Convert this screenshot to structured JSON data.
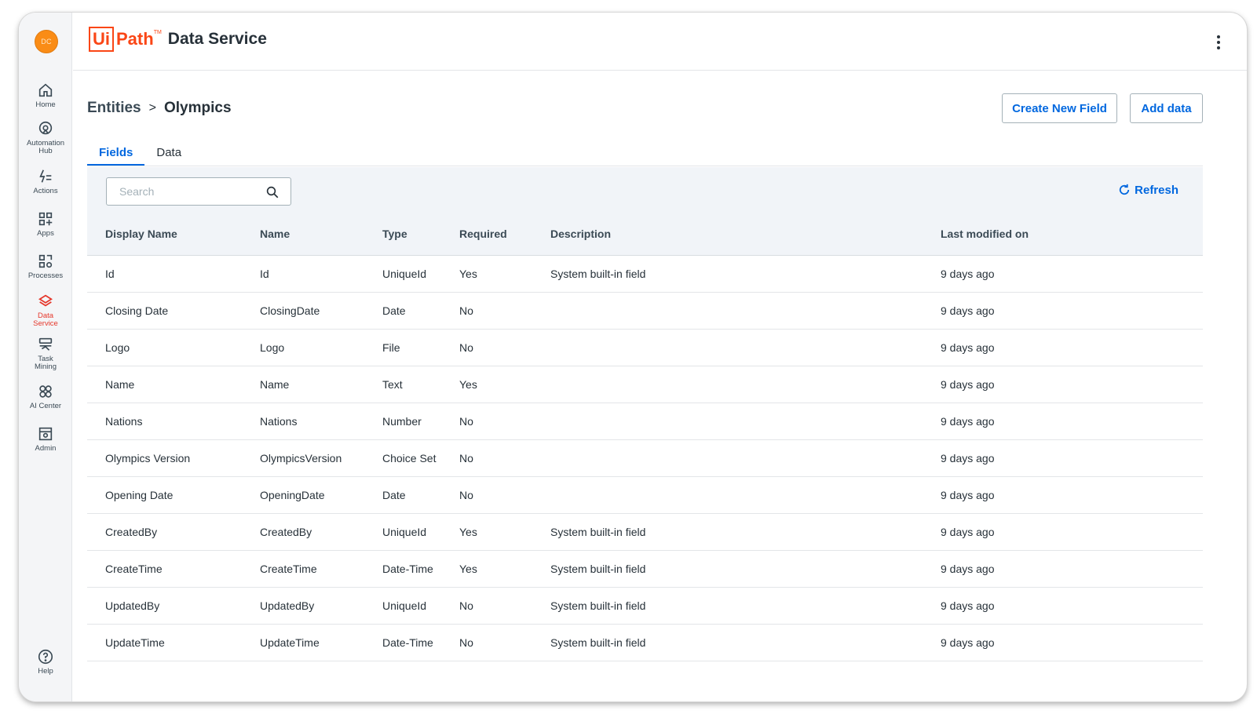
{
  "user": {
    "initials": "DC"
  },
  "nav": [
    {
      "label": "Home",
      "icon": "home-icon"
    },
    {
      "label": "Automation Hub",
      "icon": "automation-hub-icon"
    },
    {
      "label": "Actions",
      "icon": "actions-icon"
    },
    {
      "label": "Apps",
      "icon": "apps-icon"
    },
    {
      "label": "Processes",
      "icon": "processes-icon"
    },
    {
      "label": "Data Service",
      "icon": "data-service-icon",
      "active": true
    },
    {
      "label": "Task Mining",
      "icon": "task-mining-icon"
    },
    {
      "label": "AI Center",
      "icon": "ai-center-icon"
    },
    {
      "label": "Admin",
      "icon": "admin-icon"
    },
    {
      "label": "Help",
      "icon": "help-icon"
    }
  ],
  "header": {
    "logo_ui": "Ui",
    "logo_path": "Path",
    "logo_tm": "TM",
    "app_name": "Data Service"
  },
  "breadcrumb": {
    "root": "Entities",
    "separator": ">",
    "current": "Olympics"
  },
  "actions": {
    "create_field": "Create New Field",
    "add_data": "Add data"
  },
  "tabs": [
    {
      "label": "Fields",
      "active": true
    },
    {
      "label": "Data"
    }
  ],
  "toolbar": {
    "search_placeholder": "Search",
    "search_value": "",
    "refresh_label": "Refresh"
  },
  "table": {
    "columns": [
      "Display Name",
      "Name",
      "Type",
      "Required",
      "Description",
      "Last modified on"
    ],
    "rows": [
      [
        "Id",
        "Id",
        "UniqueId",
        "Yes",
        "System built-in field",
        "9 days ago"
      ],
      [
        "Closing Date",
        "ClosingDate",
        "Date",
        "No",
        "",
        "9 days ago"
      ],
      [
        "Logo",
        "Logo",
        "File",
        "No",
        "",
        "9 days ago"
      ],
      [
        "Name",
        "Name",
        "Text",
        "Yes",
        "",
        "9 days ago"
      ],
      [
        "Nations",
        "Nations",
        "Number",
        "No",
        "",
        "9 days ago"
      ],
      [
        "Olympics Version",
        "OlympicsVersion",
        "Choice Set",
        "No",
        "",
        "9 days ago"
      ],
      [
        "Opening Date",
        "OpeningDate",
        "Date",
        "No",
        "",
        "9 days ago"
      ],
      [
        "CreatedBy",
        "CreatedBy",
        "UniqueId",
        "Yes",
        "System built-in field",
        "9 days ago"
      ],
      [
        "CreateTime",
        "CreateTime",
        "Date-Time",
        "Yes",
        "System built-in field",
        "9 days ago"
      ],
      [
        "UpdatedBy",
        "UpdatedBy",
        "UniqueId",
        "No",
        "System built-in field",
        "9 days ago"
      ],
      [
        "UpdateTime",
        "UpdateTime",
        "Date-Time",
        "No",
        "System built-in field",
        "9 days ago"
      ]
    ]
  },
  "colors": {
    "accent": "#0067df",
    "brand": "#fa4616",
    "active_nav": "#e5372b"
  }
}
